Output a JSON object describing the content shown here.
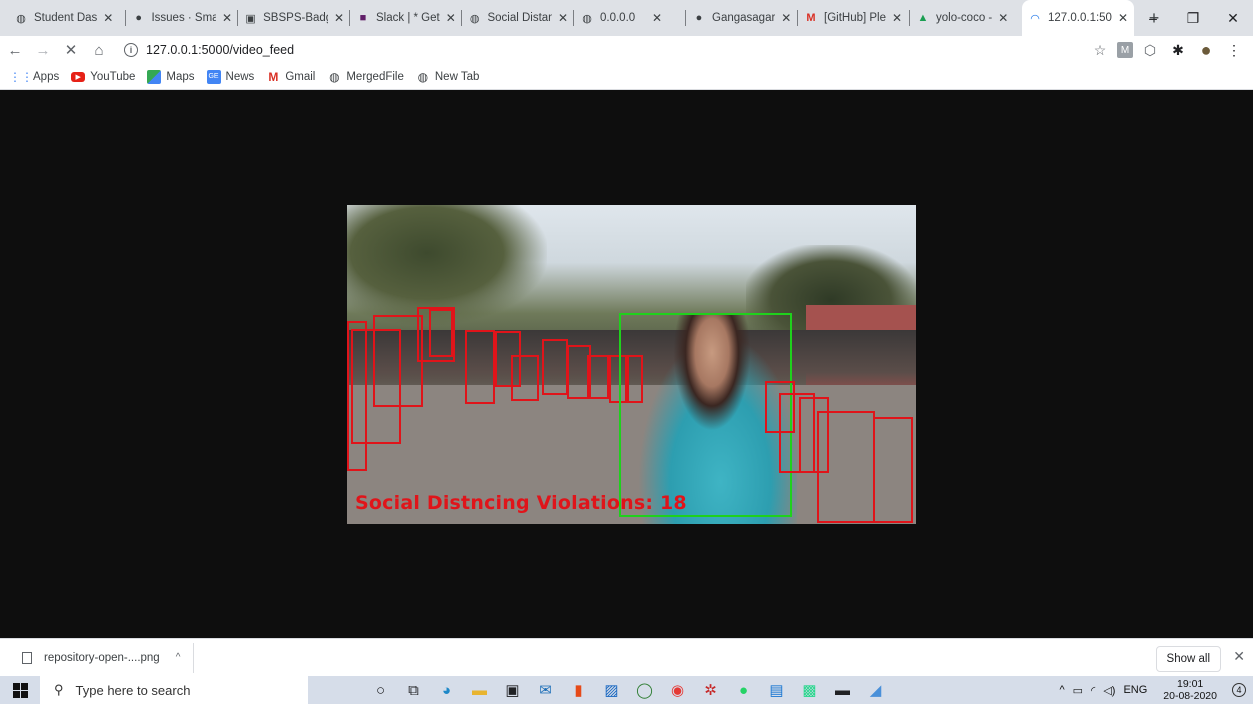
{
  "browser": {
    "tabs": [
      {
        "title": "Student Das",
        "icon": "globe-icon",
        "active": false
      },
      {
        "title": "Issues · Sma",
        "icon": "github-icon",
        "active": false
      },
      {
        "title": "SBSPS-Badg",
        "icon": "document-icon",
        "active": false
      },
      {
        "title": "Slack | * Get",
        "icon": "slack-icon",
        "active": false
      },
      {
        "title": "Social Distan",
        "icon": "globe-icon",
        "active": false
      },
      {
        "title": "0.0.0.0",
        "icon": "globe-icon",
        "active": false
      },
      {
        "title": "Gangasagar",
        "icon": "github-icon",
        "active": false
      },
      {
        "title": "[GitHub] Ple",
        "icon": "gmail-icon",
        "active": false
      },
      {
        "title": "yolo-coco -",
        "icon": "drive-icon",
        "active": false
      },
      {
        "title": "127.0.0.1:50",
        "icon": "loading-icon",
        "active": true
      }
    ],
    "new_tab_glyph": "+",
    "window_controls": {
      "minimize": "–",
      "maximize": "❐",
      "close": "✕"
    },
    "toolbar": {
      "back": "←",
      "forward": "→",
      "stop": "✕",
      "home": "⌂",
      "url": "127.0.0.1:5000/video_feed",
      "info_glyph": "i"
    },
    "extensions": [
      "☆",
      "M",
      "⬡",
      "✱",
      "●",
      "⋮"
    ],
    "bookmarks": [
      {
        "label": "Apps",
        "icon": "apps-grid-icon"
      },
      {
        "label": "YouTube",
        "icon": "youtube-icon"
      },
      {
        "label": "Maps",
        "icon": "maps-icon"
      },
      {
        "label": "News",
        "icon": "news-icon"
      },
      {
        "label": "Gmail",
        "icon": "gmail-icon"
      },
      {
        "label": "MergedFile",
        "icon": "globe-icon"
      },
      {
        "label": "New Tab",
        "icon": "globe-icon"
      }
    ]
  },
  "video": {
    "overlay_text": "Social Distncing Violations: 18",
    "violation_color": "#e0141a",
    "safe_color": "#1fd11c"
  },
  "downloads": {
    "file_name": "repository-open-....png",
    "chevron": "^",
    "show_all": "Show all",
    "close": "✕"
  },
  "taskbar": {
    "search_placeholder": "Type here to search",
    "apps": [
      "cortana-icon",
      "task-view-icon",
      "edge-icon",
      "file-explorer-icon",
      "store-icon",
      "mail-icon",
      "office-icon",
      "photos-icon",
      "circle-app-icon",
      "chrome-icon",
      "app-icon",
      "whatsapp-icon",
      "calendar-icon",
      "pycharm-icon",
      "terminal-icon",
      "notes-icon"
    ],
    "tray": {
      "language": "ENG",
      "time": "19:01",
      "date": "20-08-2020",
      "notifications": "4"
    }
  }
}
